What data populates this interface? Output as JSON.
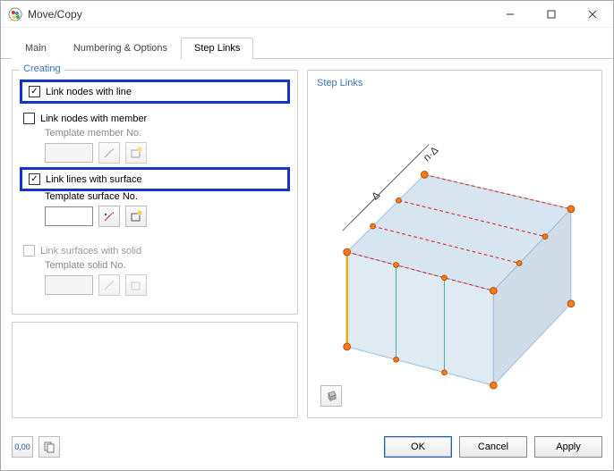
{
  "window": {
    "title": "Move/Copy"
  },
  "tabs": {
    "main": "Main",
    "numbering": "Numbering & Options",
    "steplinks": "Step Links",
    "active": "steplinks"
  },
  "creating": {
    "title": "Creating",
    "link_nodes_line": {
      "label": "Link nodes with line",
      "checked": true
    },
    "link_nodes_member": {
      "label": "Link nodes with member",
      "checked": false
    },
    "template_member": {
      "label": "Template member No.",
      "value": ""
    },
    "link_lines_surface": {
      "label": "Link lines with surface",
      "checked": true
    },
    "template_surface": {
      "label": "Template surface No.",
      "value": ""
    },
    "link_surfaces_solid": {
      "label": "Link surfaces with solid",
      "checked": false,
      "enabled": false
    },
    "template_solid": {
      "label": "Template solid No.",
      "value": ""
    }
  },
  "preview": {
    "title": "Step Links",
    "delta_label": "Δ",
    "count_label": "n·Δ"
  },
  "buttons": {
    "ok": "OK",
    "cancel": "Cancel",
    "apply": "Apply"
  },
  "bb_icons": {
    "units": "0,00",
    "copy": "copy-icon"
  },
  "colors": {
    "highlight": "#1633c9",
    "group_title": "#3a72b8"
  }
}
